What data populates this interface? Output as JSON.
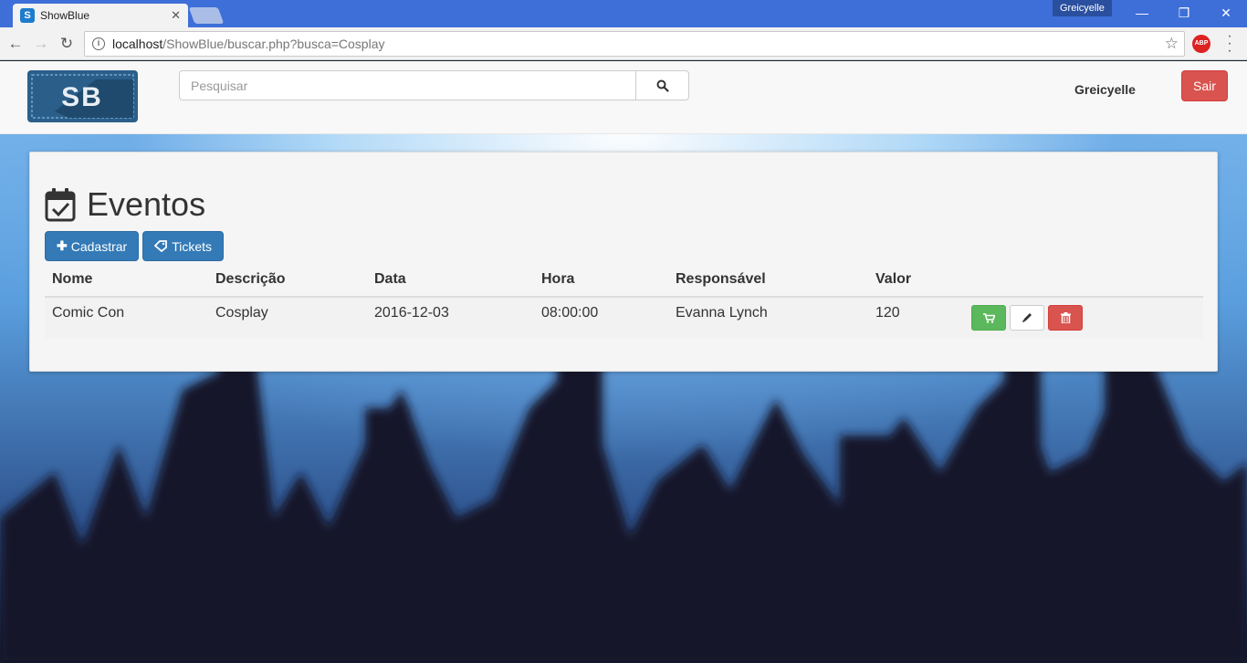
{
  "browser": {
    "tab_title": "ShowBlue",
    "tab_favicon_letter": "S",
    "user_badge": "Greicyelle",
    "url_host": "localhost",
    "url_path": "/ShowBlue/buscar.php?busca=Cosplay",
    "abp_label": "ABP"
  },
  "navbar": {
    "logo_text": "SB",
    "search_placeholder": "Pesquisar",
    "search_value": "",
    "user_name": "Greicyelle",
    "logout_label": "Sair"
  },
  "main": {
    "title": "Eventos",
    "buttons": {
      "cadastrar": "Cadastrar",
      "tickets": "Tickets"
    },
    "table": {
      "headers": [
        "Nome",
        "Descrição",
        "Data",
        "Hora",
        "Responsável",
        "Valor"
      ],
      "rows": [
        {
          "nome": "Comic Con",
          "descricao": "Cosplay",
          "data": "2016-12-03",
          "hora": "08:00:00",
          "responsavel": "Evanna Lynch",
          "valor": "120"
        }
      ]
    }
  },
  "colors": {
    "primary": "#337ab7",
    "danger": "#d9534f",
    "success": "#5cb85c",
    "chrome_blue": "#3e6fd8"
  },
  "icons": [
    "calendar-check-icon",
    "plus-icon",
    "tag-icon",
    "search-icon",
    "cart-icon",
    "pencil-icon",
    "trash-icon"
  ]
}
